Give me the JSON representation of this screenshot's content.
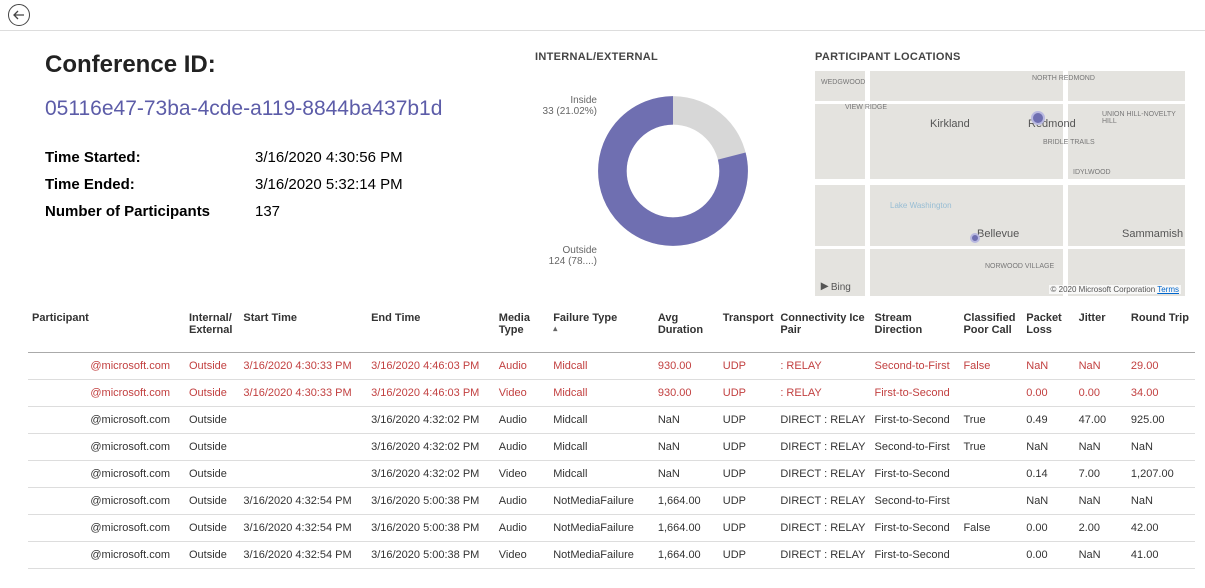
{
  "nav": {
    "back": "←"
  },
  "header": {
    "title": "Conference ID:",
    "id": "05116e47-73ba-4cde-a119-8844ba437b1d",
    "started_label": "Time Started:",
    "started_value": "3/16/2020 4:30:56 PM",
    "ended_label": "Time Ended:",
    "ended_value": "3/16/2020 5:32:14 PM",
    "participants_label": "Number of Participants",
    "participants_value": "137"
  },
  "donut": {
    "title": "INTERNAL/EXTERNAL",
    "inside_label": "Inside",
    "inside_value": "33 (21.02%)",
    "outside_label": "Outside",
    "outside_value": "124 (78....)"
  },
  "chart_data": {
    "type": "pie",
    "title": "INTERNAL/EXTERNAL",
    "categories": [
      "Inside",
      "Outside"
    ],
    "values": [
      33,
      124
    ],
    "colors": [
      "#d7d7d7",
      "#6f6fb1"
    ]
  },
  "map": {
    "title": "PARTICIPANT LOCATIONS",
    "attrib": "Bing",
    "copyright": "© 2020 Microsoft Corporation",
    "terms": "Terms",
    "places": [
      "Kirkland",
      "Redmond",
      "Bellevue",
      "Sammamish",
      "Lake Washington",
      "VIEW RIDGE",
      "WEDGWOOD",
      "BRIDLE TRAILS",
      "IDYLWOOD",
      "NORTH REDMOND",
      "NORWOOD VILLAGE",
      "UNION HILL-NOVELTY HILL"
    ]
  },
  "table": {
    "headers": {
      "participant": "Participant",
      "ie": "Internal/\nExternal",
      "start": "Start Time",
      "end": "End Time",
      "media": "Media Type",
      "failure": "Failure Type",
      "avg": "Avg Duration",
      "transport": "Transport",
      "conn": "Connectivity Ice Pair",
      "stream": "Stream Direction",
      "classified": "Classified Poor Call",
      "packet": "Packet Loss",
      "jitter": "Jitter",
      "round": "Round Trip"
    },
    "rows": [
      {
        "red": true,
        "participant": "@microsoft.com",
        "ie": "Outside",
        "start": "3/16/2020 4:30:33 PM",
        "end": "3/16/2020 4:46:03 PM",
        "media": "Audio",
        "failure": "Midcall",
        "avg": "930.00",
        "transport": "UDP",
        "conn": ": RELAY",
        "stream": "Second-to-First",
        "classified": "False",
        "packet": "NaN",
        "jitter": "NaN",
        "round": "29.00"
      },
      {
        "red": true,
        "participant": "@microsoft.com",
        "ie": "Outside",
        "start": "3/16/2020 4:30:33 PM",
        "end": "3/16/2020 4:46:03 PM",
        "media": "Video",
        "failure": "Midcall",
        "avg": "930.00",
        "transport": "UDP",
        "conn": ": RELAY",
        "stream": "First-to-Second",
        "classified": "",
        "packet": "0.00",
        "jitter": "0.00",
        "round": "34.00"
      },
      {
        "red": false,
        "participant": "@microsoft.com",
        "ie": "Outside",
        "start": "",
        "end": "3/16/2020 4:32:02 PM",
        "media": "Audio",
        "failure": "Midcall",
        "avg": "NaN",
        "transport": "UDP",
        "conn": "DIRECT : RELAY",
        "stream": "First-to-Second",
        "classified": "True",
        "packet": "0.49",
        "jitter": "47.00",
        "round": "925.00"
      },
      {
        "red": false,
        "participant": "@microsoft.com",
        "ie": "Outside",
        "start": "",
        "end": "3/16/2020 4:32:02 PM",
        "media": "Audio",
        "failure": "Midcall",
        "avg": "NaN",
        "transport": "UDP",
        "conn": "DIRECT : RELAY",
        "stream": "Second-to-First",
        "classified": "True",
        "packet": "NaN",
        "jitter": "NaN",
        "round": "NaN"
      },
      {
        "red": false,
        "participant": "@microsoft.com",
        "ie": "Outside",
        "start": "",
        "end": "3/16/2020 4:32:02 PM",
        "media": "Video",
        "failure": "Midcall",
        "avg": "NaN",
        "transport": "UDP",
        "conn": "DIRECT : RELAY",
        "stream": "First-to-Second",
        "classified": "",
        "packet": "0.14",
        "jitter": "7.00",
        "round": "1,207.00"
      },
      {
        "red": false,
        "participant": "@microsoft.com",
        "ie": "Outside",
        "start": "3/16/2020 4:32:54 PM",
        "end": "3/16/2020 5:00:38 PM",
        "media": "Audio",
        "failure": "NotMediaFailure",
        "avg": "1,664.00",
        "transport": "UDP",
        "conn": "DIRECT : RELAY",
        "stream": "Second-to-First",
        "classified": "",
        "packet": "NaN",
        "jitter": "NaN",
        "round": "NaN"
      },
      {
        "red": false,
        "participant": "@microsoft.com",
        "ie": "Outside",
        "start": "3/16/2020 4:32:54 PM",
        "end": "3/16/2020 5:00:38 PM",
        "media": "Audio",
        "failure": "NotMediaFailure",
        "avg": "1,664.00",
        "transport": "UDP",
        "conn": "DIRECT : RELAY",
        "stream": "First-to-Second",
        "classified": "False",
        "packet": "0.00",
        "jitter": "2.00",
        "round": "42.00"
      },
      {
        "red": false,
        "participant": "@microsoft.com",
        "ie": "Outside",
        "start": "3/16/2020 4:32:54 PM",
        "end": "3/16/2020 5:00:38 PM",
        "media": "Video",
        "failure": "NotMediaFailure",
        "avg": "1,664.00",
        "transport": "UDP",
        "conn": "DIRECT : RELAY",
        "stream": "First-to-Second",
        "classified": "",
        "packet": "0.00",
        "jitter": "NaN",
        "round": "41.00"
      }
    ]
  }
}
